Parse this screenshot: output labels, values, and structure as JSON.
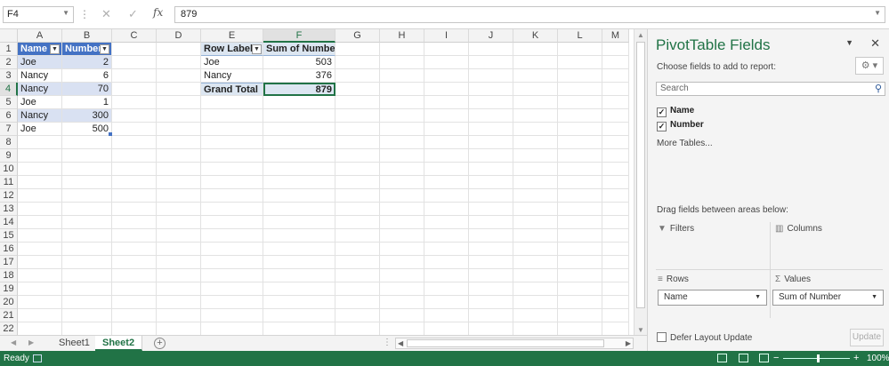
{
  "formula_bar": {
    "name_box": "F4",
    "cancel_icon": "✕",
    "enter_icon": "✓",
    "fx_label": "fx",
    "formula_value": "879"
  },
  "grid": {
    "columns": [
      "A",
      "B",
      "C",
      "D",
      "E",
      "F",
      "G",
      "H",
      "I",
      "J",
      "K",
      "L",
      "M"
    ],
    "rows": [
      "1",
      "2",
      "3",
      "4",
      "5",
      "6",
      "7",
      "8",
      "9",
      "10",
      "11",
      "12",
      "13",
      "14",
      "15",
      "16",
      "17",
      "18",
      "19",
      "20",
      "21",
      "22"
    ],
    "selected_cell": "F4",
    "source_table": {
      "headers": [
        "Name",
        "Number"
      ],
      "rows": [
        [
          "Joe",
          "2"
        ],
        [
          "Nancy",
          "6"
        ],
        [
          "Nancy",
          "70"
        ],
        [
          "Joe",
          "1"
        ],
        [
          "Nancy",
          "300"
        ],
        [
          "Joe",
          "500"
        ]
      ]
    },
    "pivot_table": {
      "headers": [
        "Row Labels",
        "Sum of Number"
      ],
      "rows": [
        [
          "Joe",
          "503"
        ],
        [
          "Nancy",
          "376"
        ]
      ],
      "total": [
        "Grand Total",
        "879"
      ]
    }
  },
  "sheet_tabs": {
    "tabs": [
      "Sheet1",
      "Sheet2"
    ],
    "active": "Sheet2"
  },
  "status_bar": {
    "ready": "Ready",
    "zoom": "100%"
  },
  "pivot_pane": {
    "title": "PivotTable Fields",
    "choose_text": "Choose fields to add to report:",
    "search_placeholder": "Search",
    "fields": [
      {
        "label": "Name",
        "checked": true
      },
      {
        "label": "Number",
        "checked": true
      }
    ],
    "more_tables": "More Tables...",
    "drag_text": "Drag fields between areas below:",
    "areas": {
      "filters": "Filters",
      "columns": "Columns",
      "rows": "Rows",
      "values": "Values"
    },
    "rows_field": "Name",
    "values_field": "Sum of Number",
    "defer_label": "Defer Layout Update",
    "update_label": "Update"
  }
}
